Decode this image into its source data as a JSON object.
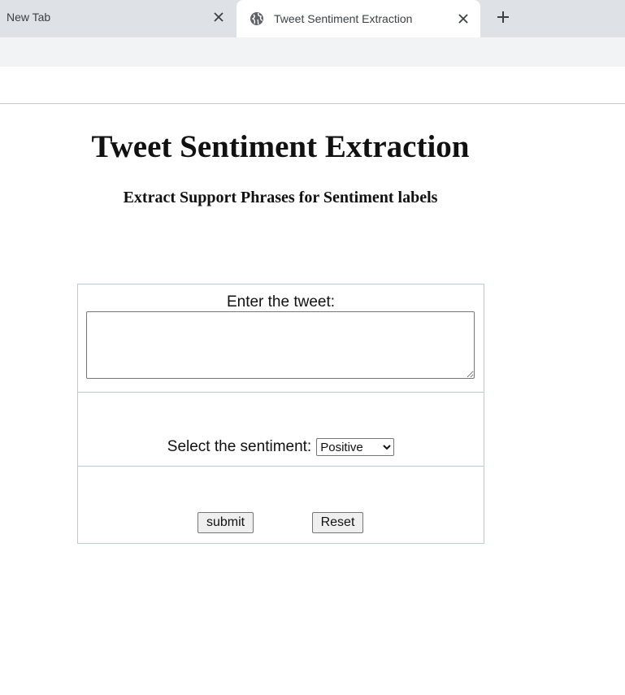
{
  "browser": {
    "tabs": [
      {
        "title": "New Tab",
        "active": false
      },
      {
        "title": "Tweet Sentiment Extraction",
        "active": true
      }
    ],
    "icons": {
      "close": "close-icon",
      "new_tab": "plus-icon",
      "favicon": "globe-icon"
    }
  },
  "page": {
    "title": "Tweet Sentiment Extraction",
    "subtitle": "Extract Support Phrases for Sentiment labels"
  },
  "form": {
    "tweet_label": "Enter the tweet:",
    "tweet_value": "",
    "sentiment_label": "Select the sentiment:",
    "sentiment_selected": "Positive",
    "submit_label": "submit",
    "reset_label": "Reset"
  },
  "colors": {
    "tabstrip": "#dee1e6",
    "toolbar": "#f1f3f4",
    "table_border": "#b9cfcf"
  }
}
